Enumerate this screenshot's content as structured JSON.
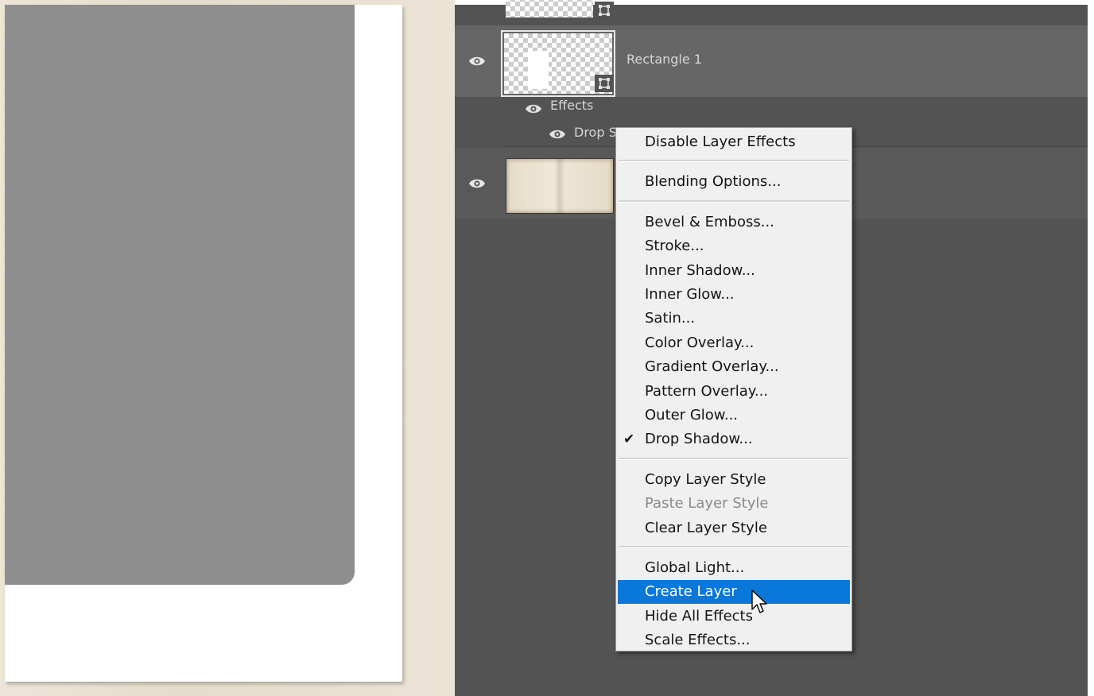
{
  "layers": {
    "items": [
      {
        "name": "Rectangle 1"
      },
      {
        "name": "Effects"
      },
      {
        "name": "Drop S"
      }
    ]
  },
  "context_menu": {
    "groups": [
      [
        {
          "label": "Disable Layer Effects",
          "enabled": true
        }
      ],
      [
        {
          "label": "Blending Options...",
          "enabled": true
        }
      ],
      [
        {
          "label": "Bevel & Emboss...",
          "enabled": true
        },
        {
          "label": "Stroke...",
          "enabled": true
        },
        {
          "label": "Inner Shadow...",
          "enabled": true
        },
        {
          "label": "Inner Glow...",
          "enabled": true
        },
        {
          "label": "Satin...",
          "enabled": true
        },
        {
          "label": "Color Overlay...",
          "enabled": true
        },
        {
          "label": "Gradient Overlay...",
          "enabled": true
        },
        {
          "label": "Pattern Overlay...",
          "enabled": true
        },
        {
          "label": "Outer Glow...",
          "enabled": true
        },
        {
          "label": "Drop Shadow...",
          "enabled": true,
          "checked": true
        }
      ],
      [
        {
          "label": "Copy Layer Style",
          "enabled": true
        },
        {
          "label": "Paste Layer Style",
          "enabled": false
        },
        {
          "label": "Clear Layer Style",
          "enabled": true
        }
      ],
      [
        {
          "label": "Global Light...",
          "enabled": true
        },
        {
          "label": "Create Layer",
          "enabled": true,
          "highlighted": true
        },
        {
          "label": "Hide All Effects",
          "enabled": true
        },
        {
          "label": "Scale Effects...",
          "enabled": true
        }
      ]
    ],
    "check_glyph": "✔"
  },
  "colors": {
    "panel_bg": "#535353",
    "selected_row": "#666666",
    "menu_bg": "#f0f0f0",
    "menu_highlight": "#0a78d8"
  },
  "icons": [
    "eye-icon",
    "shape-layer-icon",
    "checkmark-icon",
    "mouse-cursor-icon"
  ]
}
